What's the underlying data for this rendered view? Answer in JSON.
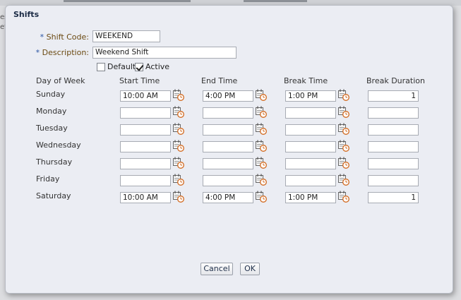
{
  "background": {
    "partial_text": [
      "es",
      "etc"
    ]
  },
  "dialog": {
    "title": "Shifts",
    "required_marker": "*",
    "shift_code": {
      "label": "Shift Code:",
      "value": "WEEKEND"
    },
    "description": {
      "label": "Description:",
      "value": "Weekend Shift"
    },
    "default_checkbox": {
      "label": "Default",
      "checked": false
    },
    "active_checkbox": {
      "label": "Active",
      "checked": true
    },
    "columns": [
      "Day of Week",
      "Start Time",
      "End Time",
      "Break Time",
      "Break Duration"
    ],
    "rows": [
      {
        "day": "Sunday",
        "start": "10:00 AM",
        "end": "4:00 PM",
        "break_time": "1:00 PM",
        "break_duration": "1"
      },
      {
        "day": "Monday",
        "start": "",
        "end": "",
        "break_time": "",
        "break_duration": ""
      },
      {
        "day": "Tuesday",
        "start": "",
        "end": "",
        "break_time": "",
        "break_duration": ""
      },
      {
        "day": "Wednesday",
        "start": "",
        "end": "",
        "break_time": "",
        "break_duration": ""
      },
      {
        "day": "Thursday",
        "start": "",
        "end": "",
        "break_time": "",
        "break_duration": ""
      },
      {
        "day": "Friday",
        "start": "",
        "end": "",
        "break_time": "",
        "break_duration": ""
      },
      {
        "day": "Saturday",
        "start": "10:00 AM",
        "end": "4:00 PM",
        "break_time": "1:00 PM",
        "break_duration": "1"
      }
    ],
    "buttons": {
      "cancel": "Cancel",
      "ok": "OK"
    }
  },
  "icons": {
    "time_picker": "calendar-clock-icon"
  },
  "colors": {
    "dialog_bg": "#ebedf3",
    "label_text": "#6b4a12",
    "required_marker": "#2a55a3",
    "clock_accent": "#d2691e"
  }
}
